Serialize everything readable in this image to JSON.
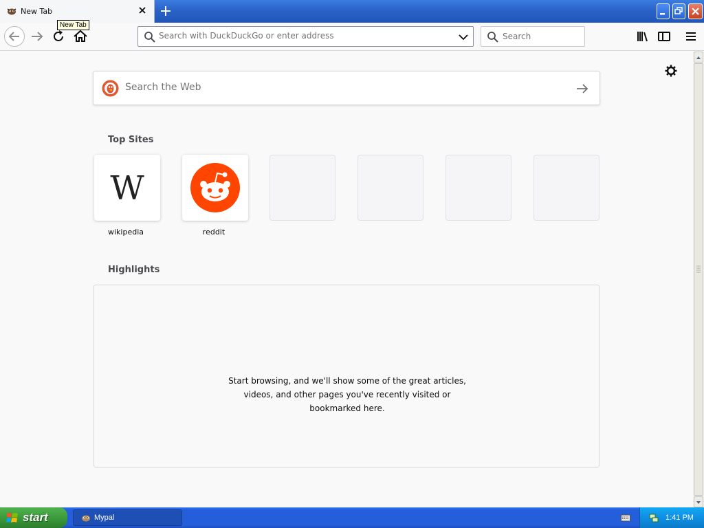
{
  "browser": {
    "tab": {
      "title": "New Tab"
    },
    "tooltip": "New Tab",
    "urlbar": {
      "placeholder": "Search with DuckDuckGo or enter address"
    },
    "searchbar": {
      "placeholder": "Search"
    }
  },
  "newtab": {
    "web_search": {
      "placeholder": "Search the Web"
    },
    "top_sites_title": "Top Sites",
    "top_sites": [
      {
        "label": "wikipedia",
        "icon": "wikipedia-logo"
      },
      {
        "label": "reddit",
        "icon": "reddit-logo"
      },
      {
        "label": ""
      },
      {
        "label": ""
      },
      {
        "label": ""
      },
      {
        "label": ""
      }
    ],
    "highlights_title": "Highlights",
    "highlights_message": "Start browsing, and we'll show some of the great articles, videos, and other pages you've recently visited or bookmarked here."
  },
  "taskbar": {
    "start_label": "start",
    "tasks": [
      {
        "label": "Mypal",
        "icon": "mypal-icon"
      }
    ],
    "clock": "1:41 PM"
  },
  "colors": {
    "titlebar_blue": "#2a63c8",
    "reddit_orange": "#ff4500",
    "ddg_orange": "#de5833",
    "start_green": "#3c9a3c"
  }
}
